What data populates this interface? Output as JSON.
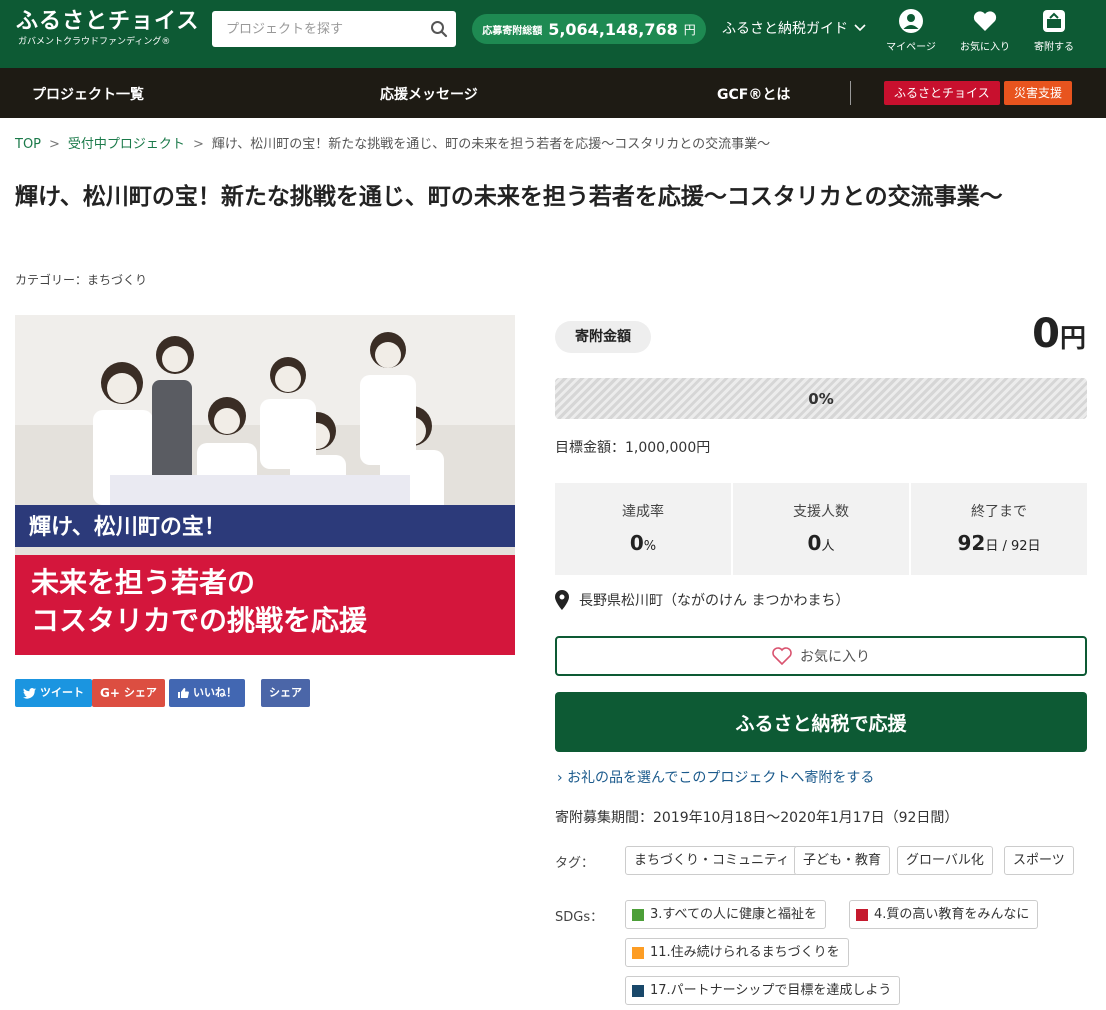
{
  "header": {
    "logo_main": "ふるさとチョイス",
    "logo_sub": "ガバメントクラウドファンディング®",
    "search_placeholder": "プロジェクトを探す",
    "total_label": "応募寄附総額",
    "total_value": "5,064,148,768",
    "total_unit": "円",
    "guide_label": "ふるさと納税ガイド",
    "icons": {
      "mypage": "マイページ",
      "favorites": "お気に入り",
      "donate": "寄附する"
    }
  },
  "nav": {
    "projects": "プロジェクト一覧",
    "messages": "応援メッセージ",
    "about": "GCF®とは",
    "badge_choice": "ふるさとチョイス",
    "badge_disaster": "災害支援"
  },
  "breadcrumb": {
    "top": "TOP",
    "accepting": "受付中プロジェクト",
    "current": "輝け、松川町の宝！新たな挑戦を通じ、町の未来を担う若者を応援～コスタリカとの交流事業～"
  },
  "project": {
    "title": "輝け、松川町の宝！新たな挑戦を通じ、町の未来を担う若者を応援～コスタリカとの交流事業～",
    "category": "カテゴリー：まちづくり",
    "hero_line1": "輝け、松川町の宝！",
    "hero_line2": "未来を担う若者の",
    "hero_line3": "コスタリカでの挑戦を応援"
  },
  "share": {
    "tweet": "ツイート",
    "gplus": "シェア",
    "like": "いいね！",
    "fb_share": "シェア"
  },
  "funding": {
    "amount_label": "寄附金額",
    "amount_value": "0",
    "amount_unit": "円",
    "progress_text": "0%",
    "progress": 0,
    "goal": "目標金額：1,000,000円",
    "stats": {
      "rate_label": "達成率",
      "rate_value": "0",
      "rate_unit": "%",
      "supporters_label": "支援人数",
      "supporters_value": "0",
      "supporters_unit": "人",
      "remaining_label": "終了まで",
      "remaining_value": "92",
      "remaining_unit": "日 / 92日"
    },
    "location": "長野県松川町（ながのけん まつかわまち）",
    "favorite_button": "お気に入り",
    "cta_button": "ふるさと納税で応援",
    "gift_link": "お礼の品を選んでこのプロジェクトへ寄附をする",
    "period": "寄附募集期間：2019年10月18日～2020年1月17日（92日間）"
  },
  "tags": {
    "label": "タグ：",
    "items": [
      "まちづくり・コミュニティ",
      "子ども・教育",
      "グローバル化",
      "スポーツ"
    ]
  },
  "sdgs": {
    "label": "SDGs：",
    "items": [
      {
        "text": "3.すべての人に健康と福祉を",
        "color": "#4c9f38"
      },
      {
        "text": "4.質の高い教育をみんなに",
        "color": "#c5192d"
      },
      {
        "text": "11.住み続けられるまちづくりを",
        "color": "#fd9d24"
      },
      {
        "text": "17.パートナーシップで目標を達成しよう",
        "color": "#19486a"
      }
    ]
  },
  "colors": {
    "brand_green": "#0d5a34",
    "nav_dark": "#1e1b14",
    "badge_red": "#c8102e",
    "badge_orange": "#e8541e",
    "twitter": "#1b95e0",
    "gplus": "#dc4e41",
    "facebook": "#4267b2"
  }
}
